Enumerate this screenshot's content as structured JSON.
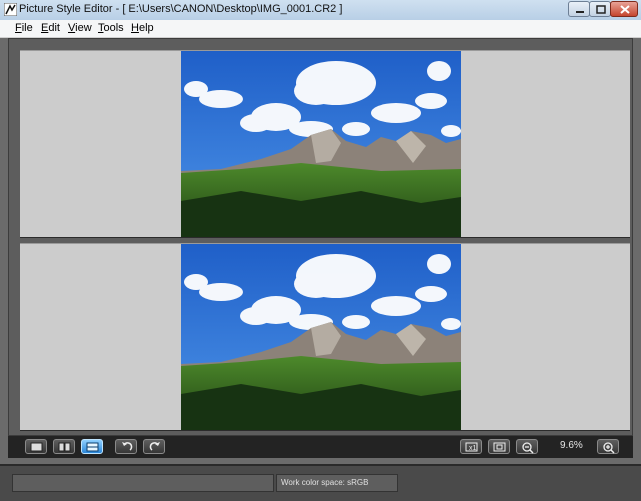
{
  "window": {
    "title": "Picture Style Editor - [ E:\\Users\\CANON\\Desktop\\IMG_0001.CR2 ]"
  },
  "menu": {
    "items": [
      {
        "label": "File",
        "mnemonic": "F",
        "rest": "ile"
      },
      {
        "label": "Edit",
        "mnemonic": "E",
        "rest": "dit"
      },
      {
        "label": "View",
        "mnemonic": "V",
        "rest": "iew"
      },
      {
        "label": "Tools",
        "mnemonic": "T",
        "rest": "ools"
      },
      {
        "label": "Help",
        "mnemonic": "H",
        "rest": "elp"
      }
    ]
  },
  "images": {
    "top": {
      "description_icon": "landscape-photo",
      "subject": "mountain-landscape"
    },
    "bottom": {
      "description_icon": "landscape-photo",
      "subject": "mountain-landscape"
    }
  },
  "toolbar": {
    "view_single": {
      "icon": "single-view-icon"
    },
    "view_side_by_side": {
      "icon": "side-by-side-view-icon"
    },
    "view_top_bottom": {
      "icon": "top-bottom-view-icon",
      "active": true
    },
    "rotate_left": {
      "icon": "rotate-left-icon"
    },
    "rotate_right": {
      "icon": "rotate-right-icon"
    },
    "actual_size": {
      "icon": "actual-size-icon"
    },
    "fit_to_window": {
      "icon": "fit-to-window-icon"
    },
    "zoom_out": {
      "icon": "zoom-out-icon"
    },
    "zoom_level": "9.6%",
    "zoom_in": {
      "icon": "zoom-in-icon"
    }
  },
  "status": {
    "color_space": "Work color space: sRGB"
  },
  "colors": {
    "active_button": "#2a86d8",
    "sky": "#2f73d6",
    "workspace_bg": "#cccccc"
  }
}
